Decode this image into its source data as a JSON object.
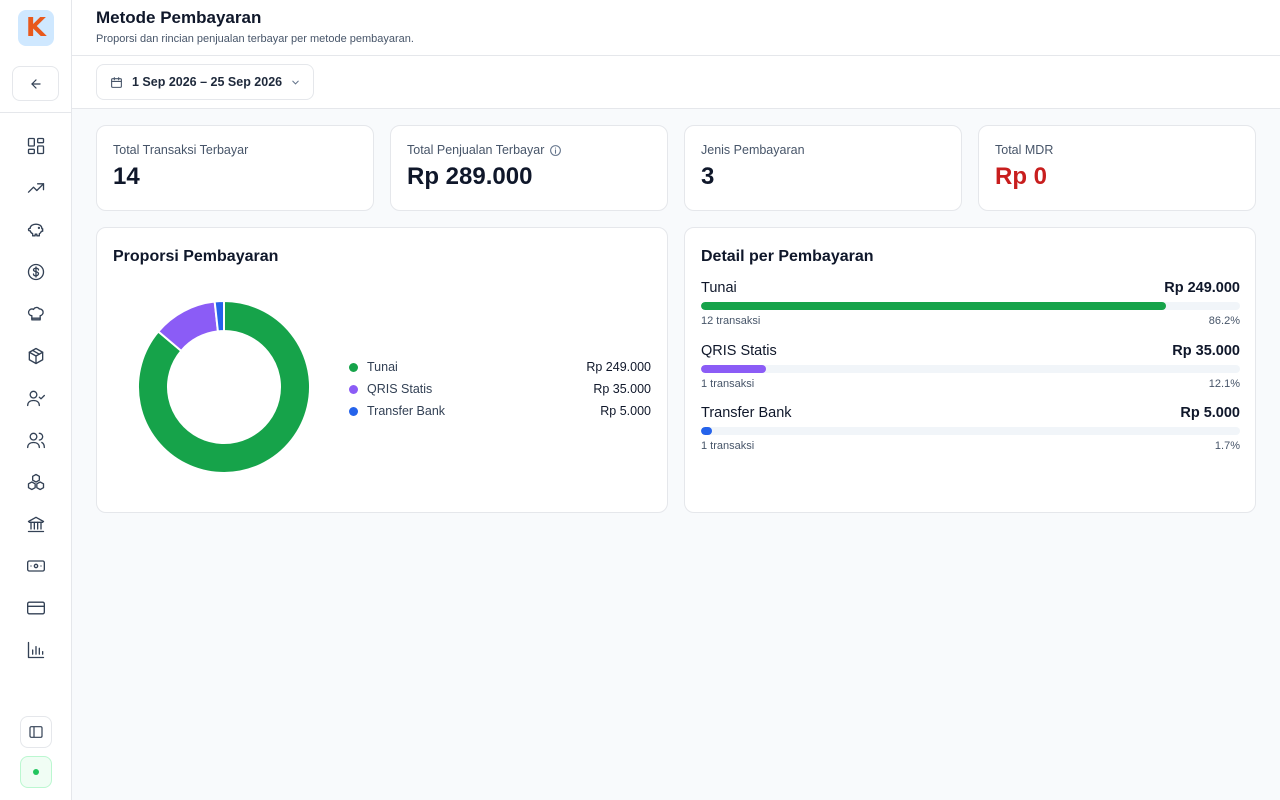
{
  "app": {
    "logo_letter": "K"
  },
  "header": {
    "title": "Metode Pembayaran",
    "subtitle": "Proporsi dan rincian penjualan terbayar per metode pembayaran."
  },
  "toolbar": {
    "date_range": "1 Sep 2026 – 25 Sep 2026"
  },
  "sidebar": {
    "items": [
      {
        "icon": "dashboard-icon"
      },
      {
        "icon": "trending-up-icon"
      },
      {
        "icon": "piggy-bank-icon"
      },
      {
        "icon": "dollar-circle-icon"
      },
      {
        "icon": "chef-hat-icon"
      },
      {
        "icon": "package-icon"
      },
      {
        "icon": "user-check-icon"
      },
      {
        "icon": "users-icon"
      },
      {
        "icon": "boxes-icon"
      },
      {
        "icon": "bank-icon"
      },
      {
        "icon": "banknote-icon"
      },
      {
        "icon": "credit-card-icon"
      },
      {
        "icon": "bar-chart-icon"
      }
    ]
  },
  "stats": [
    {
      "label": "Total Transaksi Terbayar",
      "value": "14"
    },
    {
      "label": "Total Penjualan Terbayar",
      "value": "Rp 289.000"
    },
    {
      "label": "Jenis Pembayaran",
      "value": "3"
    },
    {
      "label": "Total MDR",
      "value": "Rp 0"
    }
  ],
  "proportion_panel": {
    "title": "Proporsi Pembayaran"
  },
  "detail_panel": {
    "title": "Detail per Pembayaran"
  },
  "payments": [
    {
      "name": "Tunai",
      "amount": "Rp 249.000",
      "transactions": "12 transaksi",
      "percent_label": "86.2%",
      "percent": 86.2,
      "color": "#16a34a"
    },
    {
      "name": "QRIS Statis",
      "amount": "Rp 35.000",
      "transactions": "1 transaksi",
      "percent_label": "12.1%",
      "percent": 12.1,
      "color": "#8b5cf6"
    },
    {
      "name": "Transfer Bank",
      "amount": "Rp 5.000",
      "transactions": "1 transaksi",
      "percent_label": "1.7%",
      "percent": 1.7,
      "color": "#2563eb"
    }
  ],
  "chart_data": {
    "type": "pie",
    "categories": [
      "Tunai",
      "QRIS Statis",
      "Transfer Bank"
    ],
    "values": [
      249000,
      35000,
      5000
    ],
    "title": "Proporsi Pembayaran",
    "colors": [
      "#16a34a",
      "#8b5cf6",
      "#2563eb"
    ],
    "legend": "right"
  },
  "colors": {
    "accent_green": "#16a34a",
    "mdr_red": "#c81e1e"
  }
}
